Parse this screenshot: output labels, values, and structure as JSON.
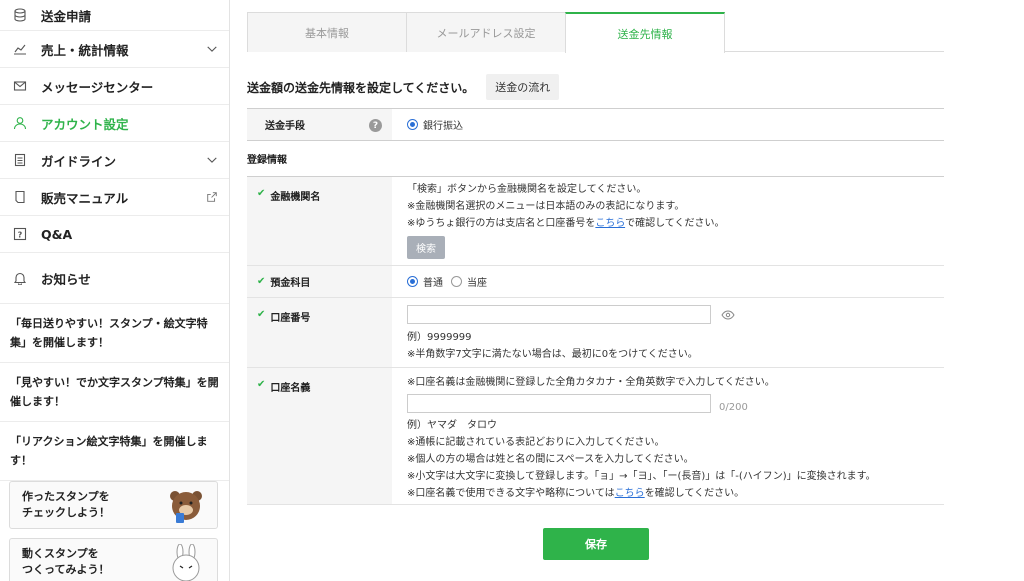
{
  "sidebar": {
    "items": [
      {
        "label": "送金申請",
        "icon": "database-icon"
      },
      {
        "label": "売上・統計情報",
        "icon": "chart-icon"
      },
      {
        "label": "メッセージセンター",
        "icon": "mail-icon"
      },
      {
        "label": "アカウント設定",
        "icon": "person-icon"
      },
      {
        "label": "ガイドライン",
        "icon": "document-icon"
      },
      {
        "label": "販売マニュアル",
        "icon": "page-icon"
      },
      {
        "label": "Q&A",
        "icon": "question-icon"
      }
    ],
    "notice": {
      "label": "お知らせ",
      "icon": "bell-icon"
    },
    "news": [
      "「毎日送りやすい！スタンプ・絵文字特集」を開催します！",
      "「見やすい！でか文字スタンプ特集」を開催します！",
      "「リアクション絵文字特集」を開催します！"
    ],
    "promos": [
      {
        "line1": "作ったスタンプを",
        "line2": "チェックしよう！"
      },
      {
        "line1": "動くスタンプを",
        "line2": "つくってみよう！"
      }
    ]
  },
  "tabs": [
    {
      "label": "基本情報"
    },
    {
      "label": "メールアドレス設定"
    },
    {
      "label": "送金先情報"
    }
  ],
  "heading": {
    "text": "送金額の送金先情報を設定してください。",
    "flow_button": "送金の流れ"
  },
  "form": {
    "method": {
      "label": "送金手段",
      "value": "銀行振込"
    },
    "section_title": "登録情報",
    "bank": {
      "label": "金融機関名",
      "line1": "「検索」ボタンから金融機関名を設定してください。",
      "line2": "※金融機関名選択のメニューは日本語のみの表記になります。",
      "line3_pre": "※ゆうちょ銀行の方は支店名と口座番号を",
      "line3_link": "こちら",
      "line3_post": "で確認してください。",
      "search_button": "検索"
    },
    "account_type": {
      "label": "預金科目",
      "opt1": "普通",
      "opt2": "当座"
    },
    "account_number": {
      "label": "口座番号",
      "example": "例）9999999",
      "note": "※半角数字7文字に満たない場合は、最初に0をつけてください。"
    },
    "account_name": {
      "label": "口座名義",
      "intro": "※口座名義は金融機関に登録した全角カタカナ・全角英数字で入力してください。",
      "counter": "0/200",
      "example": "例）ヤマダ　タロウ",
      "note1": "※通帳に記載されている表記どおりに入力してください。",
      "note2": "※個人の方の場合は姓と名の間にスペースを入力してください。",
      "note3": "※小文字は大文字に変換して登録します。「ョ」→「ヨ」、「ー(長音)」は「-(ハイフン)」に変換されます。",
      "note4_pre": "※口座名義で使用できる文字や略称については",
      "note4_link": "こちら",
      "note4_post": "を確認してください。"
    }
  },
  "save_label": "保存",
  "colors": {
    "accent": "#2fb34a",
    "link": "#2a6fd6"
  }
}
